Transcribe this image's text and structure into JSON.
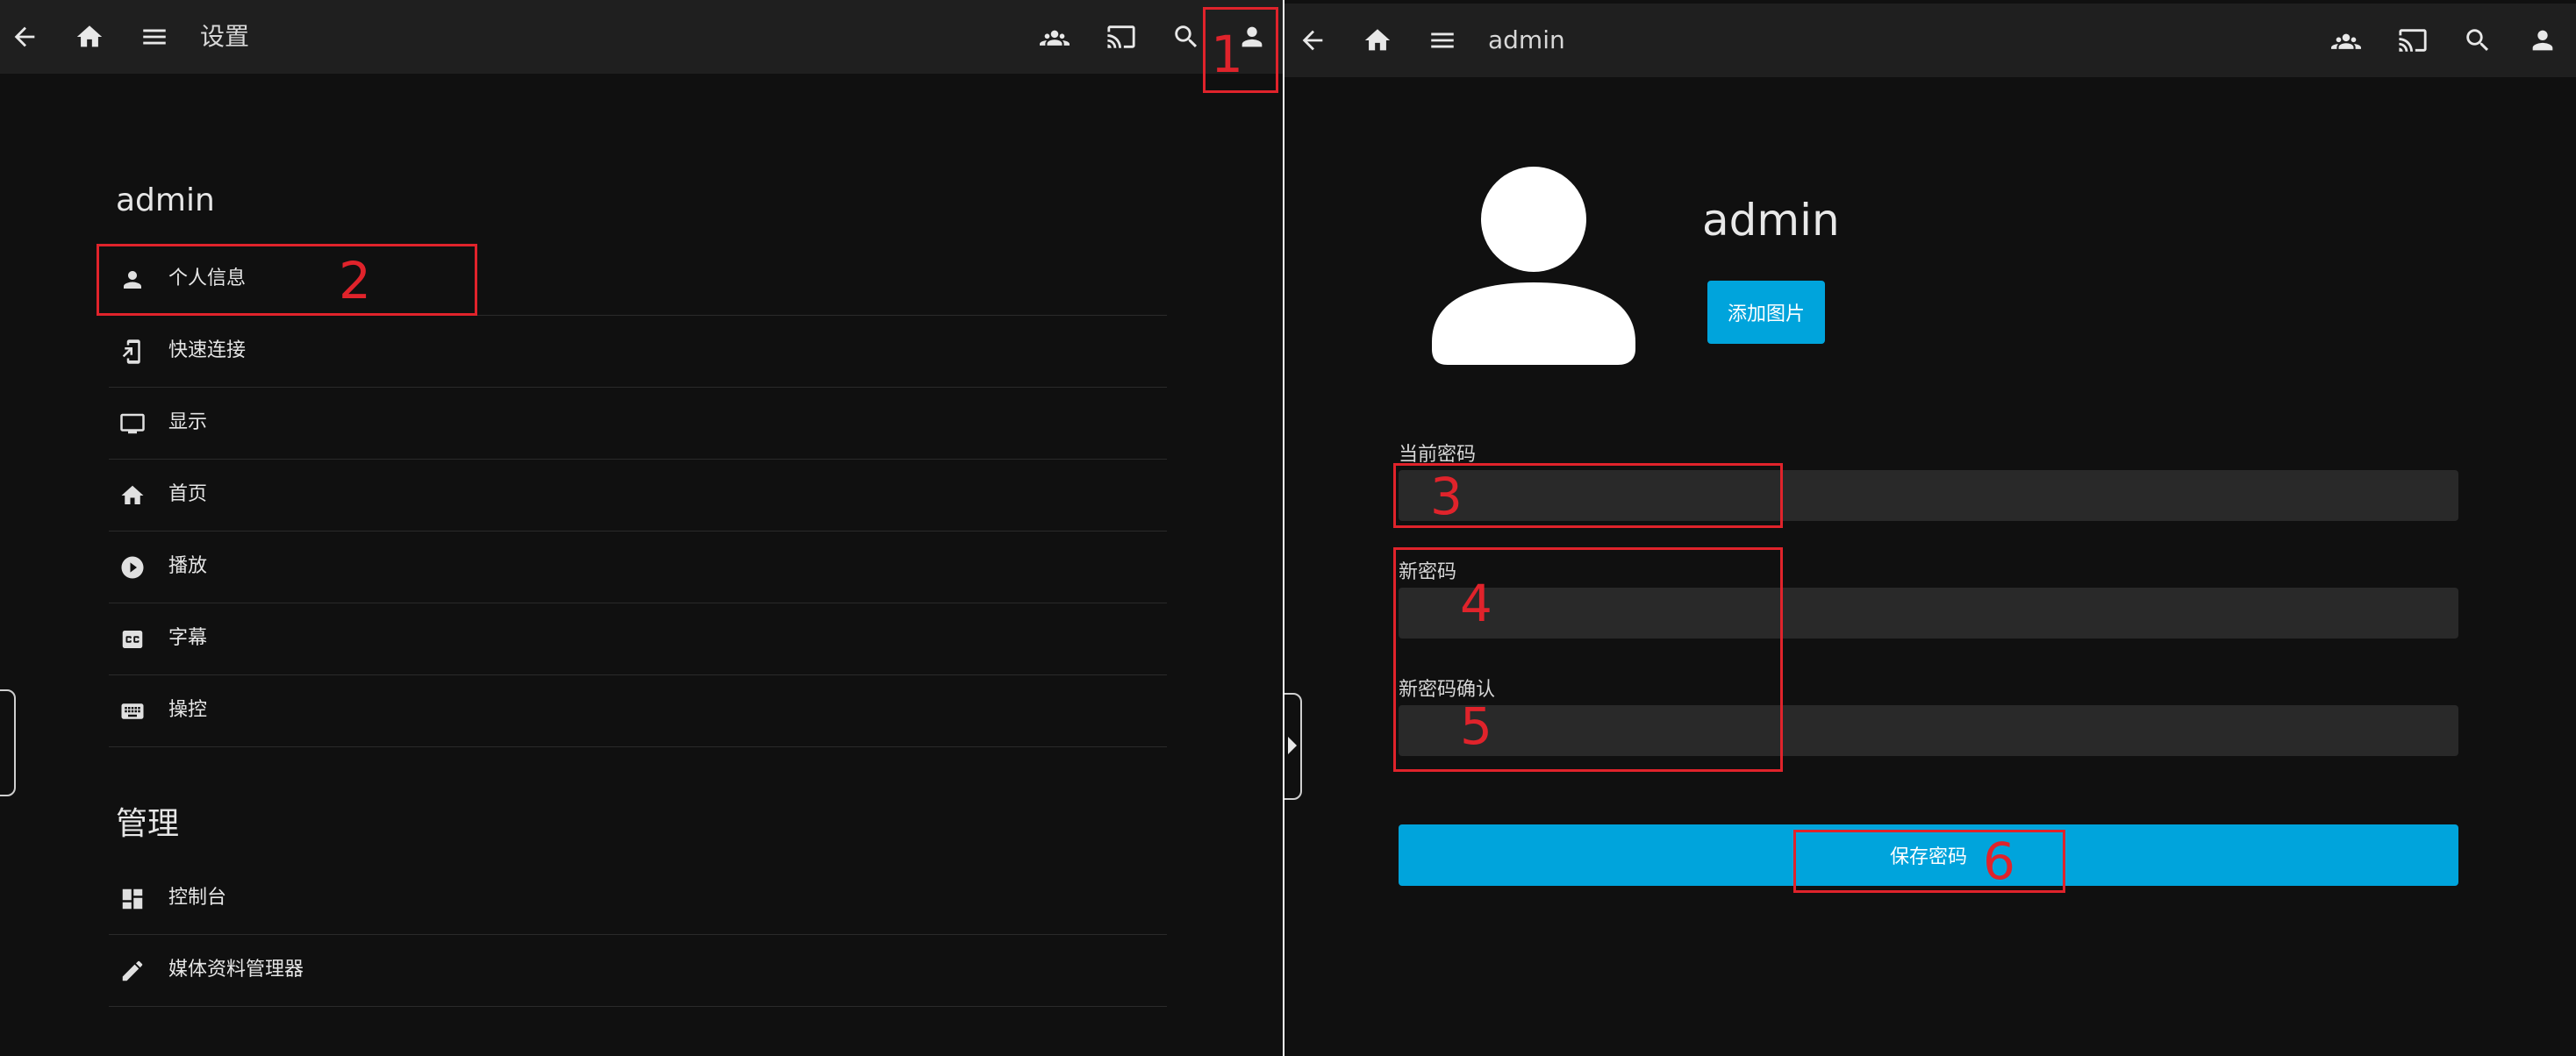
{
  "left": {
    "header": {
      "title": "设置"
    },
    "user_section": {
      "title": "admin"
    },
    "items": [
      {
        "label": "个人信息"
      },
      {
        "label": "快速连接"
      },
      {
        "label": "显示"
      },
      {
        "label": "首页"
      },
      {
        "label": "播放"
      },
      {
        "label": "字幕"
      },
      {
        "label": "操控"
      }
    ],
    "admin_section": {
      "title": "管理"
    },
    "admin_items": [
      {
        "label": "控制台"
      },
      {
        "label": "媒体资料管理器"
      }
    ]
  },
  "right": {
    "header": {
      "title": "admin"
    },
    "profile": {
      "name": "admin",
      "add_image_label": "添加图片"
    },
    "form": {
      "current_password_label": "当前密码",
      "new_password_label": "新密码",
      "confirm_password_label": "新密码确认",
      "save_label": "保存密码"
    }
  },
  "annotations": [
    "1",
    "2",
    "3",
    "4",
    "5",
    "6"
  ],
  "icons": {
    "header": [
      "back-arrow-icon",
      "home-icon",
      "menu-icon",
      "group-icon",
      "cast-icon",
      "search-icon",
      "user-icon"
    ],
    "menu": [
      "person-icon",
      "phone-link-icon",
      "monitor-icon",
      "home-icon",
      "play-circle-icon",
      "closed-caption-icon",
      "keyboard-icon",
      "dashboard-icon",
      "pencil-icon"
    ]
  },
  "colors": {
    "accent": "#00a4dc",
    "annotation": "#e0232b",
    "background": "#101010",
    "header": "#1f1f1f",
    "input": "#292929"
  }
}
